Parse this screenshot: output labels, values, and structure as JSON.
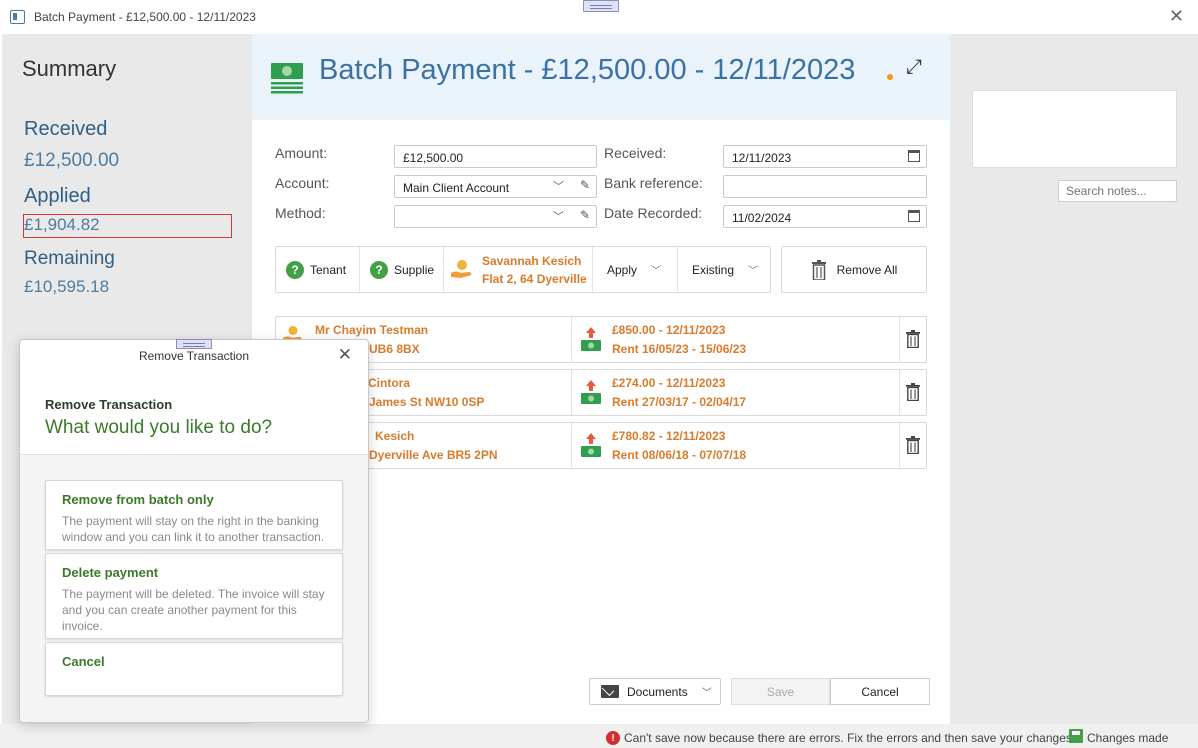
{
  "window": {
    "title": "Batch Payment - £12,500.00 - 12/11/2023"
  },
  "summary": {
    "heading": "Summary",
    "received_label": "Received",
    "received_value": "£12,500.00",
    "applied_label": "Applied",
    "applied_value": "£1,904.82",
    "remaining_label": "Remaining",
    "remaining_value": "£10,595.18"
  },
  "header": {
    "title": "Batch Payment - £12,500.00 - 12/11/2023"
  },
  "form": {
    "amount_label": "Amount:",
    "amount_value": "£12,500.00",
    "account_label": "Account:",
    "account_value": "Main Client Account",
    "method_label": "Method:",
    "method_value": "",
    "received_label": "Received:",
    "received_value": "12/11/2023",
    "bank_ref_label": "Bank reference:",
    "bank_ref_value": "",
    "date_recorded_label": "Date Recorded:",
    "date_recorded_value": "11/02/2024"
  },
  "toolbar": {
    "tenant": "Tenant",
    "supplier": "Supplie",
    "contact_name": "Savannah Kesich",
    "contact_address": "Flat 2, 64 Dyerville",
    "apply": "Apply",
    "existing": "Existing",
    "remove_all": "Remove All"
  },
  "transactions": [
    {
      "name": "Mr Chayim Testman",
      "address": "UB6 8BX",
      "payment": "£850.00 - 12/11/2023",
      "period": "Rent 16/05/23 - 15/06/23"
    },
    {
      "name": "Cintora",
      "address": "James St NW10 0SP",
      "payment": "£274.00 - 12/11/2023",
      "period": "Rent 27/03/17 - 02/04/17"
    },
    {
      "name": "Kesich",
      "address": "Dyerville Ave BR5 2PN",
      "payment": "£780.82 - 12/11/2023",
      "period": "Rent 08/06/18 - 07/07/18"
    }
  ],
  "notes": {
    "search_placeholder": "Search notes..."
  },
  "footer": {
    "documents": "Documents",
    "save": "Save",
    "cancel": "Cancel"
  },
  "status": {
    "error_message": "Can't save now because there are errors. Fix the errors and then save your changes",
    "changes": "Changes made"
  },
  "modal": {
    "title": "Remove Transaction",
    "heading": "Remove Transaction",
    "question": "What would you like to do?",
    "options": [
      {
        "title": "Remove from batch only",
        "description": "The payment will stay on the right in the banking window and you can link it to another transaction."
      },
      {
        "title": "Delete payment",
        "description": "The payment will be deleted. The invoice will stay and you can create another payment for this invoice."
      },
      {
        "title": "Cancel",
        "description": ""
      }
    ]
  },
  "colors": {
    "accent_blue": "#3a72a8",
    "orange_text": "#d97b2b",
    "green": "#3b7a2a",
    "error_red": "#d63737"
  }
}
